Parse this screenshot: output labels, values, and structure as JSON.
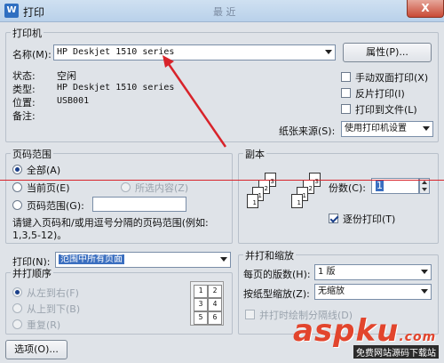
{
  "window": {
    "title": "打印",
    "title_center": "最 近",
    "app_icon": "W",
    "close_label": "X"
  },
  "printer": {
    "group_label": "打印机",
    "name_label": "名称(M):",
    "name_value": "HP Deskjet 1510 series",
    "properties_button": "属性(P)...",
    "status_label": "状态:",
    "status_value": "空闲",
    "type_label": "类型:",
    "type_value": "HP Deskjet 1510 series",
    "location_label": "位置:",
    "location_value": "USB001",
    "comment_label": "备注:",
    "manual_duplex": "手动双面打印(X)",
    "reverse_print": "反片打印(I)",
    "print_to_file": "打印到文件(L)",
    "paper_source_label": "纸张来源(S):",
    "paper_source_value": "使用打印机设置"
  },
  "page_range": {
    "group_label": "页码范围",
    "all": "全部(A)",
    "current_page": "当前页(E)",
    "selection": "所选内容(Z)",
    "pages": "页码范围(G):",
    "pages_value": "",
    "hint_line1": "请键入页码和/或用逗号分隔的页码范围(例如:",
    "hint_line2": "1,3,5-12)。"
  },
  "copies": {
    "group_label": "副本",
    "count_label": "份数(C):",
    "count_value": "1",
    "collate": "逐份打印(T)"
  },
  "print_what": {
    "label": "打印(N):",
    "value": "范围中所有页面"
  },
  "print_order": {
    "group_label": "并打顺序",
    "left_to_right": "从左到右(F)",
    "top_to_bottom": "从上到下(B)",
    "repeat": "重复(R)",
    "grid": [
      "1",
      "2",
      "3",
      "4",
      "5",
      "6"
    ]
  },
  "zoom": {
    "group_label": "并打和缩放",
    "pages_per_sheet_label": "每页的版数(H):",
    "pages_per_sheet_value": "1 版",
    "scale_label": "按纸型缩放(Z):",
    "scale_value": "无缩放",
    "draw_borders": "并打时绘制分隔线(D)"
  },
  "footer": {
    "options_button": "选项(O)..."
  },
  "watermark": {
    "main": "aspku",
    "suffix": ".com",
    "sub": "免费网站源码下载站"
  },
  "colors": {
    "annotation_red": "#d8232a"
  }
}
